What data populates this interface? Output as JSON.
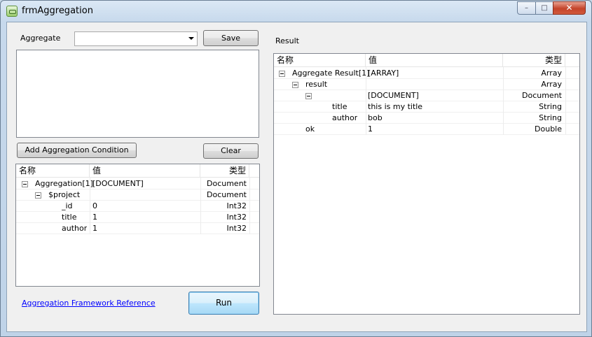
{
  "window": {
    "title": "frmAggregation",
    "minimize_glyph": "–",
    "maximize_glyph": "□",
    "close_glyph": "✕"
  },
  "left": {
    "aggregate_label": "Aggregate",
    "aggregate_value": "",
    "save_label": "Save",
    "add_condition_label": "Add Aggregation Condition",
    "clear_label": "Clear",
    "link_label": "Aggregation Framework Reference",
    "run_label": "Run",
    "tree": {
      "headers": [
        "名称",
        "值",
        "类型"
      ],
      "rows": [
        {
          "name": "Aggregation[1]",
          "value": "[DOCUMENT]",
          "type": "Document"
        },
        {
          "name": "$project",
          "value": "",
          "type": "Document"
        },
        {
          "name": "_id",
          "value": "0",
          "type": "Int32"
        },
        {
          "name": "title",
          "value": "1",
          "type": "Int32"
        },
        {
          "name": "author",
          "value": "1",
          "type": "Int32"
        }
      ]
    }
  },
  "right": {
    "result_label": "Result",
    "tree": {
      "headers": [
        "名称",
        "值",
        "类型"
      ],
      "rows": [
        {
          "name": "Aggregate Result[1]",
          "value": "[ARRAY]",
          "type": "Array"
        },
        {
          "name": "result",
          "value": "",
          "type": "Array"
        },
        {
          "name": "",
          "value": "[DOCUMENT]",
          "type": "Document"
        },
        {
          "name": "title",
          "value": "this is my title",
          "type": "String"
        },
        {
          "name": "author",
          "value": "bob",
          "type": "String"
        },
        {
          "name": "ok",
          "value": "1",
          "type": "Double"
        }
      ]
    }
  }
}
